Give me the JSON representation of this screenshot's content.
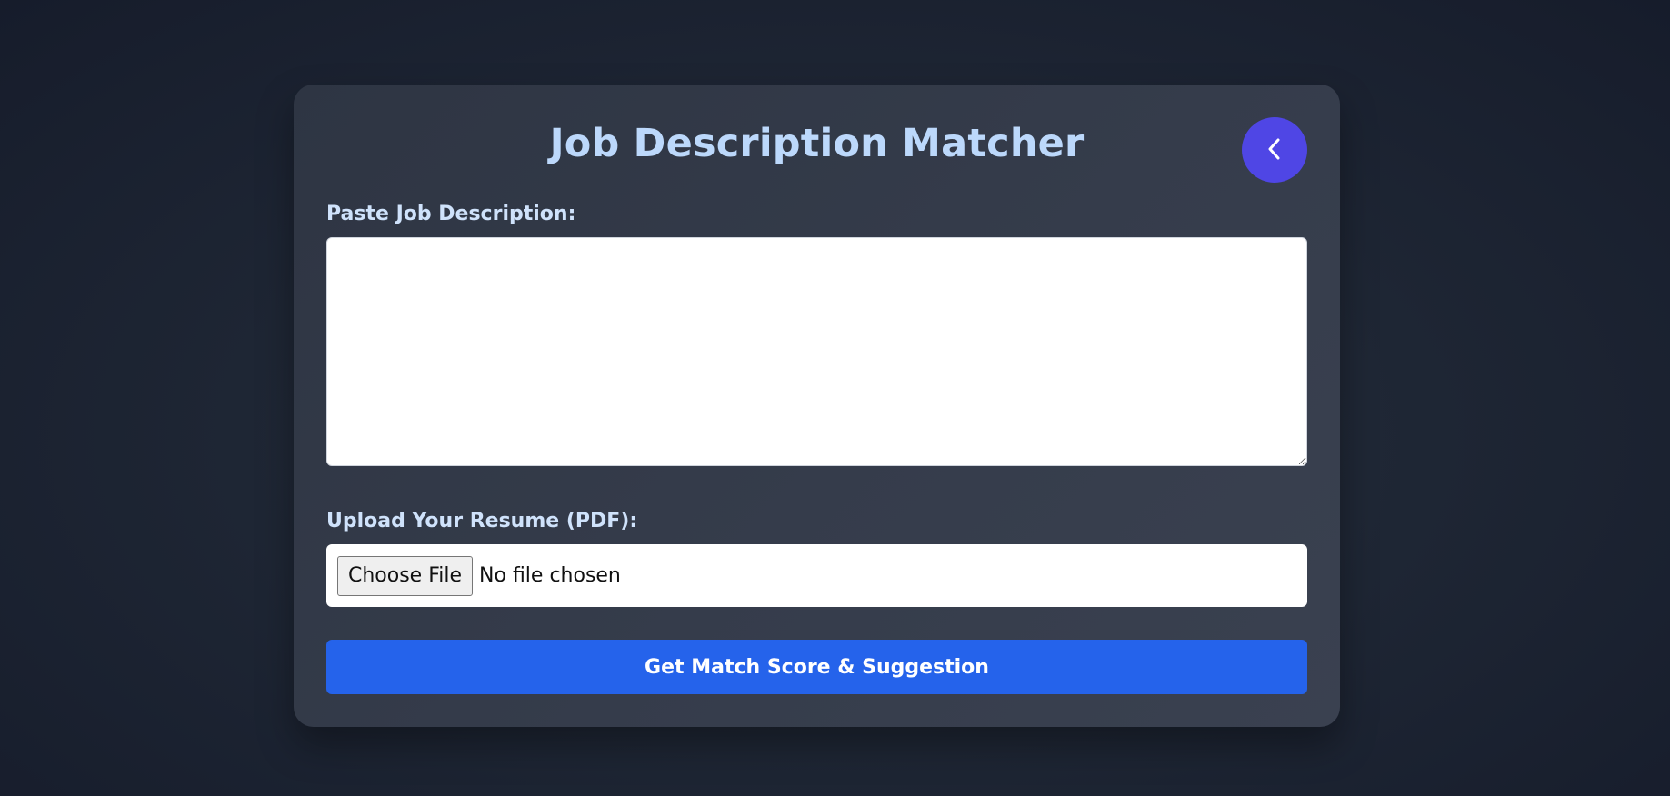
{
  "page": {
    "title": "Job Description Matcher"
  },
  "back_button": {
    "icon": "chevron-left-icon"
  },
  "job_description": {
    "label": "Paste Job Description:",
    "value": "",
    "placeholder": ""
  },
  "resume_upload": {
    "label": "Upload Your Resume (PDF):",
    "button_label": "Choose File",
    "status": "No file chosen"
  },
  "submit": {
    "label": "Get Match Score & Suggestion"
  },
  "colors": {
    "title": "#bcd8fb",
    "back_button": "#4f46e5",
    "submit_button": "#2563eb",
    "card": "#353c4b",
    "background": "#1f2735"
  }
}
